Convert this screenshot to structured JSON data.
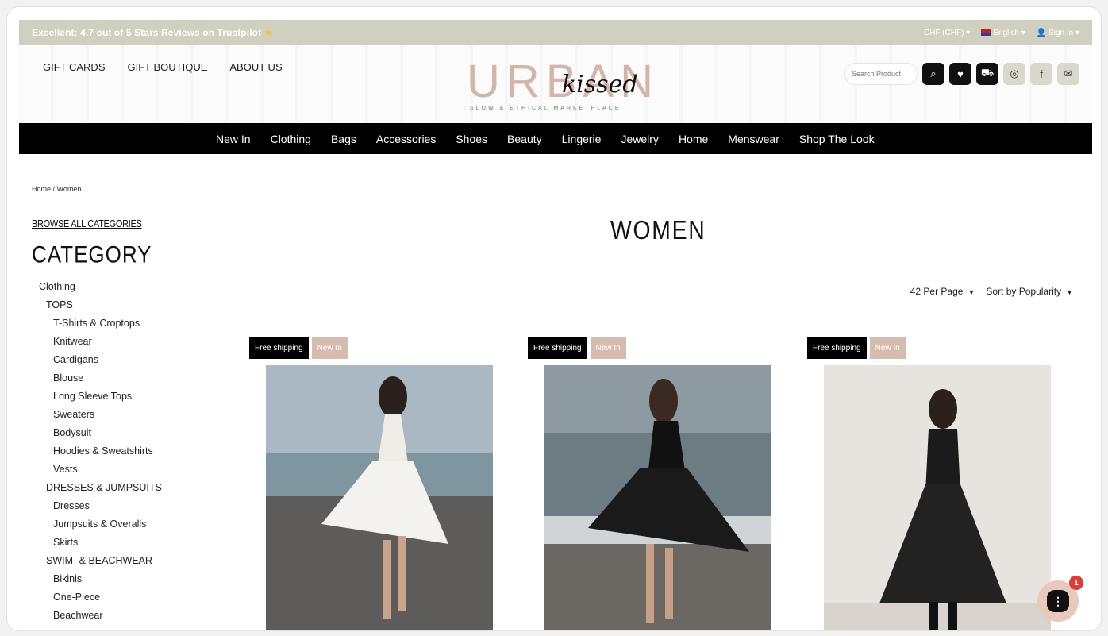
{
  "topbar": {
    "promo": "Excellent: 4.7 out of 5 Stars Reviews on Trustpilot",
    "promo_icon": "star-icon",
    "currency": "CHF (CHF) ▾",
    "language": "English ▾",
    "signin": "Sign In ▾"
  },
  "header": {
    "links": [
      "GIFT CARDS",
      "GIFT BOUTIQUE",
      "ABOUT US"
    ],
    "logo_main": "URBAN",
    "logo_script": "kissed",
    "logo_tagline": "SLOW & ETHICAL MARKETPLACE",
    "search_placeholder": "Search Product",
    "tools": {
      "search": "Q",
      "wishlist": "♥",
      "cart": "🛒",
      "instagram": "◎",
      "facebook": "f",
      "mail": "✉"
    }
  },
  "nav": [
    "New In",
    "Clothing",
    "Bags",
    "Accessories",
    "Shoes",
    "Beauty",
    "Lingerie",
    "Jewelry",
    "Home",
    "Menswear",
    "Shop The Look"
  ],
  "breadcrumb": "Home / Women",
  "sidebar": {
    "browse_all": "BROWSE ALL CATEGORIES",
    "title": "CATEGORY",
    "tree": [
      {
        "label": "Clothing",
        "level": 1
      },
      {
        "label": "TOPS",
        "level": 2
      },
      {
        "label": "T-Shirts & Croptops",
        "level": 3
      },
      {
        "label": "Knitwear",
        "level": 3
      },
      {
        "label": "Cardigans",
        "level": 3
      },
      {
        "label": "Blouse",
        "level": 3
      },
      {
        "label": "Long Sleeve Tops",
        "level": 3
      },
      {
        "label": "Sweaters",
        "level": 3
      },
      {
        "label": "Bodysuit",
        "level": 3
      },
      {
        "label": "Hoodies & Sweatshirts",
        "level": 3
      },
      {
        "label": "Vests",
        "level": 3
      },
      {
        "label": "DRESSES & JUMPSUITS",
        "level": 2
      },
      {
        "label": "Dresses",
        "level": 3
      },
      {
        "label": "Jumpsuits & Overalls",
        "level": 3
      },
      {
        "label": "Skirts",
        "level": 3
      },
      {
        "label": "SWIM- & BEACHWEAR",
        "level": 2
      },
      {
        "label": "Bikinis",
        "level": 3
      },
      {
        "label": "One-Piece",
        "level": 3
      },
      {
        "label": "Beachwear",
        "level": 3
      },
      {
        "label": "JACKETS & COATS",
        "level": 2
      }
    ]
  },
  "main": {
    "title": "WOMEN",
    "per_page": "42 Per Page",
    "sort": "Sort by Popularity",
    "products": [
      {
        "badge_shipping": "Free shipping",
        "badge_new": "New In"
      },
      {
        "badge_shipping": "Free shipping",
        "badge_new": "New In"
      },
      {
        "badge_shipping": "Free shipping",
        "badge_new": "New In"
      }
    ]
  },
  "chat": {
    "count": "1"
  },
  "colors": {
    "topbar": "#cfd0c0",
    "brand_pink": "#d4b6a8",
    "nav_bg": "#000000",
    "badge_new": "#d6bcae"
  }
}
